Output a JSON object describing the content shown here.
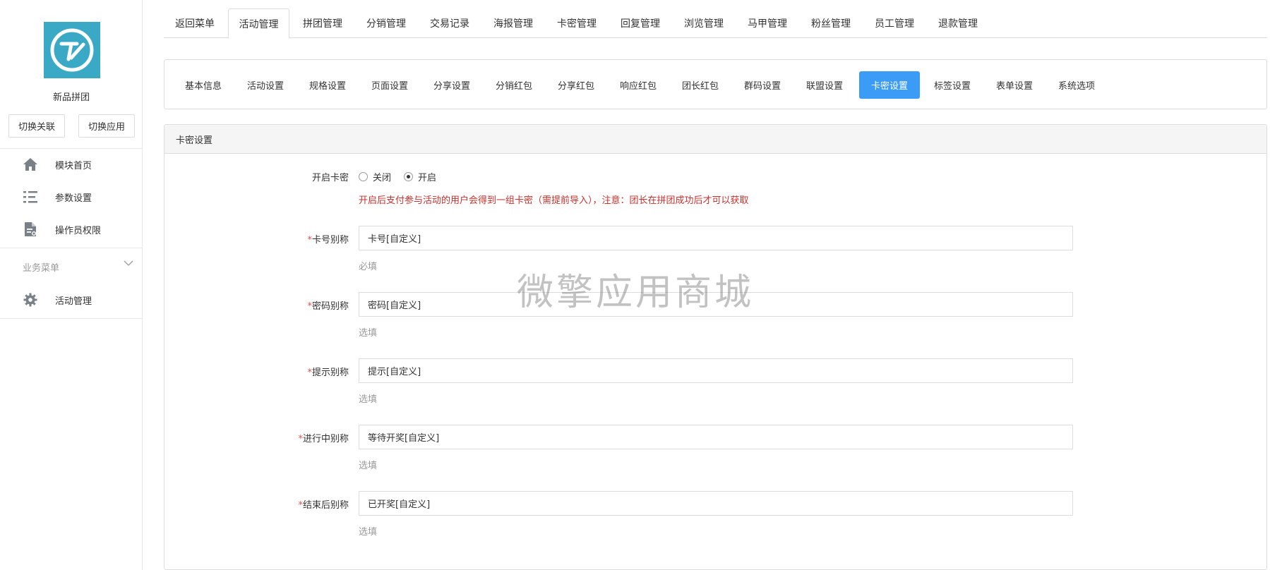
{
  "sidebar": {
    "app_name": "新品拼团",
    "switch_link_label": "切换关联",
    "switch_app_label": "切换应用",
    "items": [
      {
        "label": "模块首页",
        "icon": "home-icon"
      },
      {
        "label": "参数设置",
        "icon": "list-icon"
      },
      {
        "label": "操作员权限",
        "icon": "document-icon"
      }
    ],
    "group_title": "业务菜单",
    "group_items": [
      {
        "label": "活动管理",
        "icon": "gear-icon"
      }
    ]
  },
  "top_tabs": {
    "active_index": 1,
    "items": [
      "返回菜单",
      "活动管理",
      "拼团管理",
      "分销管理",
      "交易记录",
      "海报管理",
      "卡密管理",
      "回复管理",
      "浏览管理",
      "马甲管理",
      "粉丝管理",
      "员工管理",
      "退款管理"
    ]
  },
  "sub_nav": {
    "active_index": 11,
    "items": [
      "基本信息",
      "活动设置",
      "规格设置",
      "页面设置",
      "分享设置",
      "分销红包",
      "分享红包",
      "响应红包",
      "团长红包",
      "群码设置",
      "联盟设置",
      "卡密设置",
      "标签设置",
      "表单设置",
      "系统选项"
    ]
  },
  "panel": {
    "title": "卡密设置",
    "enable": {
      "label": "开启卡密",
      "options": [
        "关闭",
        "开启"
      ],
      "selected": "开启",
      "warning": "开启后支付参与活动的用户会得到一组卡密（需提前导入），注意：团长在拼团成功后才可以获取"
    },
    "fields": [
      {
        "label": "卡号别称",
        "required_mark": "*",
        "value": "卡号[自定义]",
        "hint": "必填"
      },
      {
        "label": "密码别称",
        "required_mark": "*",
        "value": "密码[自定义]",
        "hint": "选填"
      },
      {
        "label": "提示别称",
        "required_mark": "*",
        "value": "提示[自定义]",
        "hint": "选填"
      },
      {
        "label": "进行中别称",
        "required_mark": "*",
        "value": "等待开奖[自定义]",
        "hint": "选填"
      },
      {
        "label": "结束后别称",
        "required_mark": "*",
        "value": "已开奖[自定义]",
        "hint": "选填"
      }
    ]
  },
  "watermark": "微擎应用商城",
  "colors": {
    "accent": "#3b9cf7",
    "logo_bg": "#3aa9c6",
    "warning": "#c9302c",
    "required": "#d9534f"
  }
}
